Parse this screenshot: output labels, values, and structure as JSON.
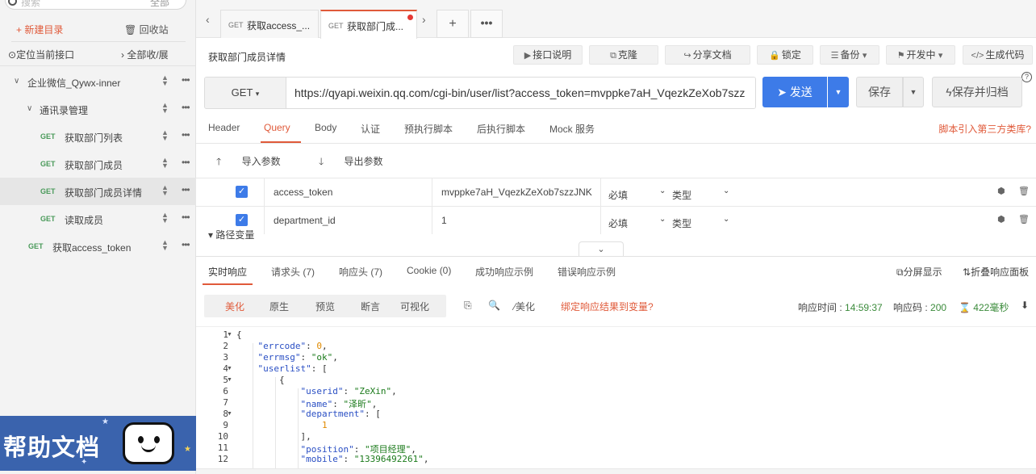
{
  "sidebar": {
    "search_placeholder": "搜索",
    "search_btn": "全部",
    "new_dir": "+ 新建目录",
    "recycle": "回收站",
    "locate": "定位当前接口",
    "expand": "全部收/展",
    "tree": [
      {
        "kind": "folder",
        "label": "企业微信_Qywx-inner",
        "caret": "∨"
      },
      {
        "kind": "folder",
        "label": "通讯录管理",
        "caret": "∨"
      },
      {
        "kind": "api",
        "method": "GET",
        "label": "获取部门列表"
      },
      {
        "kind": "api",
        "method": "GET",
        "label": "获取部门成员"
      },
      {
        "kind": "api",
        "method": "GET",
        "label": "获取部门成员详情",
        "active": true
      },
      {
        "kind": "api",
        "method": "GET",
        "label": "读取成员"
      },
      {
        "kind": "api",
        "method": "GET",
        "label": "获取access_token"
      }
    ],
    "help_banner": "帮助文档"
  },
  "tabs": [
    {
      "method": "GET",
      "title": "获取access_..."
    },
    {
      "method": "GET",
      "title": "获取部门成...",
      "active": true,
      "unsaved": true
    }
  ],
  "tab_plus": "+",
  "tab_more": "•••",
  "page_title": "获取部门成员详情",
  "toolbar": {
    "doc": "接口说明",
    "clone": "克隆",
    "share": "分享文档",
    "lock": "锁定",
    "backup": "备份",
    "dev": "开发中",
    "codegen": "生成代码"
  },
  "request": {
    "method": "GET",
    "url": "https://qyapi.weixin.qq.com/cgi-bin/user/list?access_token=mvppke7aH_VqezkZeXob7szz",
    "send": "发送",
    "save": "保存",
    "save_archive": "保存并归档"
  },
  "req_tabs": [
    "Header",
    "Query",
    "Body",
    "认证",
    "预执行脚本",
    "后执行脚本",
    "Mock 服务"
  ],
  "req_tab_active": "Query",
  "req_link": "脚本引入第三方类库?",
  "param_actions": {
    "import": "导入参数",
    "export": "导出参数"
  },
  "params": [
    {
      "checked": true,
      "key": "access_token",
      "value": "mvppke7aH_VqezkZeXob7szzJNK",
      "required": "必填",
      "type": "类型"
    },
    {
      "checked": true,
      "key": "department_id",
      "value": "1",
      "required": "必填",
      "type": "类型"
    }
  ],
  "path_var": "路径变量",
  "resp_tabs": [
    "实时响应",
    "请求头 (7)",
    "响应头 (7)",
    "Cookie (0)",
    "成功响应示例",
    "错误响应示例"
  ],
  "resp_right": {
    "split": "分屏显示",
    "fold": "折叠响应面板"
  },
  "format_tabs": [
    "美化",
    "原生",
    "预览",
    "断言",
    "可视化"
  ],
  "format_active": "美化",
  "format_tool_beautify": "美化",
  "bind_link": "绑定响应结果到变量?",
  "meta": {
    "time_label": "响应时间 :",
    "time": "14:59:37",
    "code_label": "响应码 :",
    "code": "200",
    "duration": "422毫秒"
  },
  "code_lines": [
    "{",
    "    \"errcode\": 0,",
    "    \"errmsg\": \"ok\",",
    "    \"userlist\": [",
    "        {",
    "            \"userid\": \"ZeXin\",",
    "            \"name\": \"泽昕\",",
    "            \"department\": [",
    "                1",
    "            ],",
    "            \"position\": \"项目经理\",",
    "            \"mobile\": \"13396492261\","
  ],
  "colors": {
    "accent": "#e05a3a",
    "primary": "#3d7be8",
    "get": "#4a9a5a"
  }
}
